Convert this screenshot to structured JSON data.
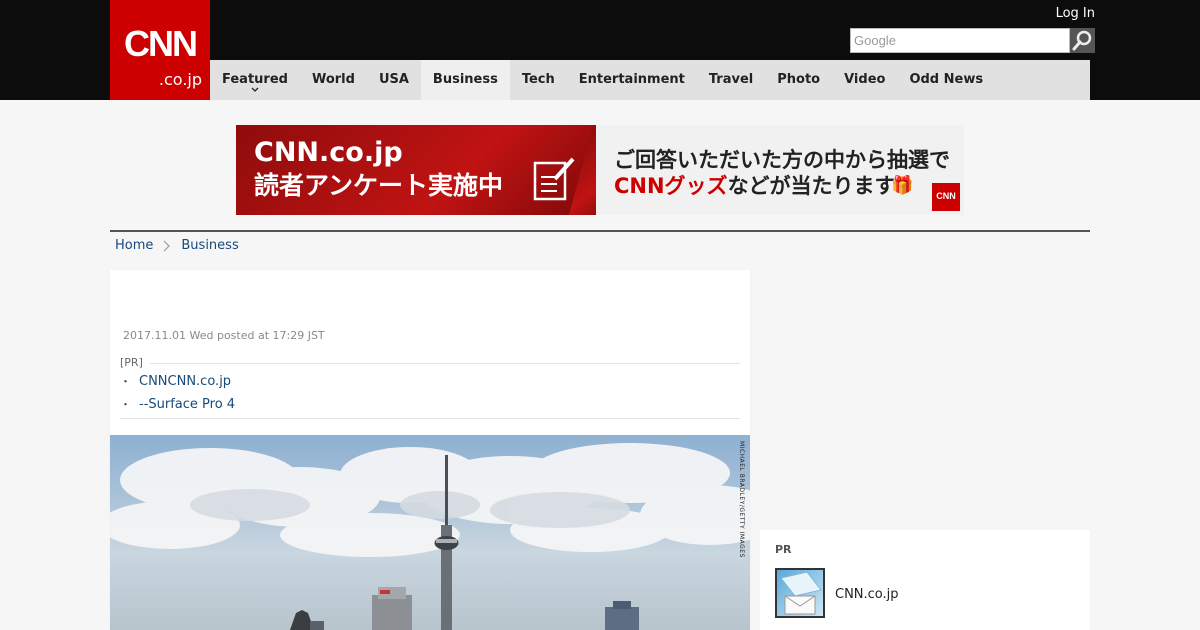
{
  "header": {
    "logo_main": "CNN",
    "logo_sub": ".co.jp",
    "login_label": "Log In",
    "search_placeholder": "Google"
  },
  "nav": {
    "items": [
      {
        "label": "Featured"
      },
      {
        "label": "World"
      },
      {
        "label": "USA"
      },
      {
        "label": "Business"
      },
      {
        "label": "Tech"
      },
      {
        "label": "Entertainment"
      },
      {
        "label": "Travel"
      },
      {
        "label": "Photo"
      },
      {
        "label": "Video"
      },
      {
        "label": "Odd News"
      }
    ],
    "active": "Business"
  },
  "banner": {
    "line1": "CNN.co.jp",
    "line2": "読者アンケート実施中",
    "line3": "ご回答いただいた方の中から抽選で",
    "line4_highlight": "CNNグッズ",
    "line4_rest": "などが当たります",
    "mini_logo": "CNN"
  },
  "breadcrumb": {
    "home": "Home",
    "section": "Business"
  },
  "article": {
    "posted": "2017.11.01 Wed posted at 17:29 JST",
    "pr_label": "[PR]",
    "pr_links": [
      {
        "bullet": "・",
        "text": "CNNCNN.co.jp"
      },
      {
        "bullet": "・",
        "text": "--Surface Pro 4"
      }
    ],
    "photo_credit": "MICHAEL BRADLEY/GETTY IMAGES"
  },
  "sidebar": {
    "pr_title": "PR",
    "pr_item_label": "CNN.co.jp"
  },
  "colors": {
    "brand_red": "#cc0000",
    "header_black": "#0c0c0c",
    "nav_gray": "#e1e1e1",
    "link_blue": "#174a7a"
  }
}
